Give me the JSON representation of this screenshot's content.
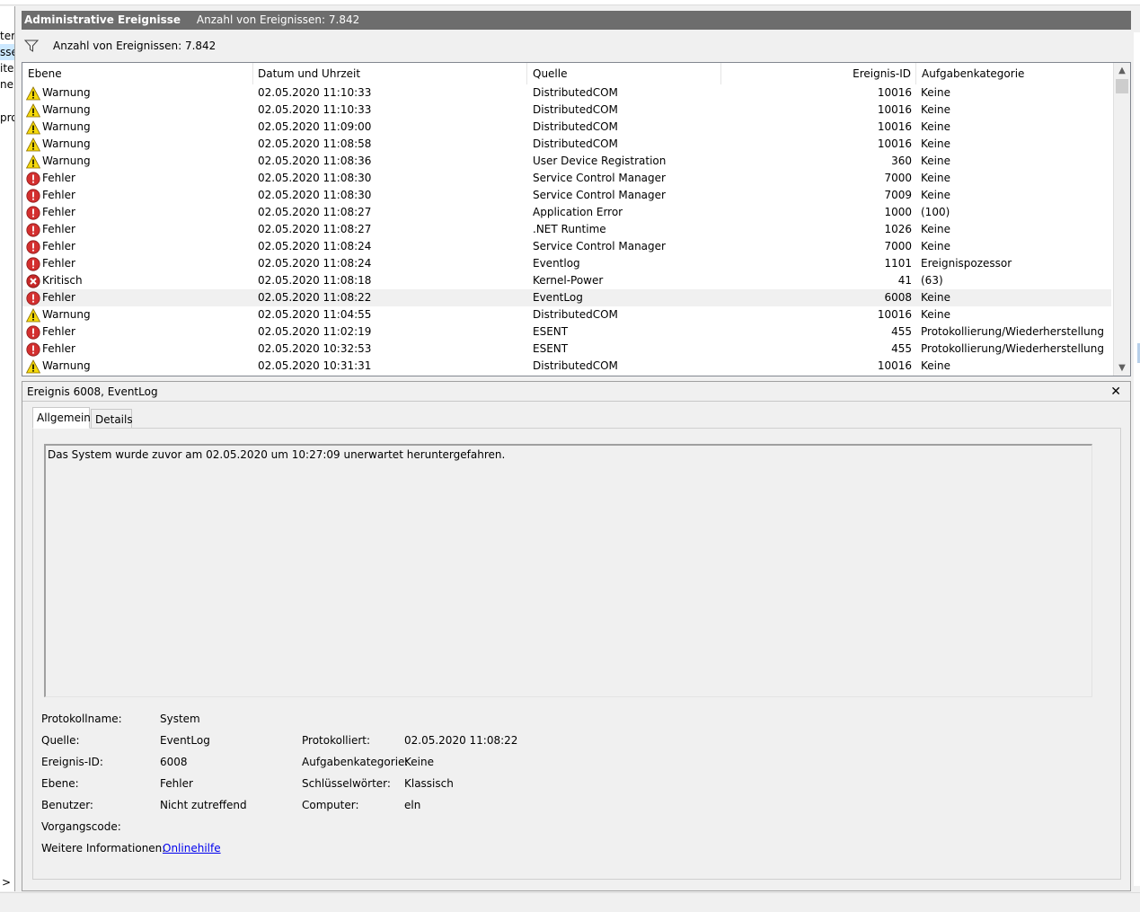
{
  "window": {
    "title_bold": "Administrative Ereignisse",
    "title_count": "Anzahl von Ereignissen: 7.842"
  },
  "left_pane": {
    "fragments": [
      "ter",
      "sse",
      "ite",
      "ner",
      "pro"
    ],
    "collapse_glyph": ">"
  },
  "filter_bar": {
    "icon": "filter-icon",
    "text": "Anzahl von Ereignissen: 7.842"
  },
  "event_list": {
    "columns": [
      "Ebene",
      "Datum und Uhrzeit",
      "Quelle",
      "Ereignis-ID",
      "Aufgabenkategorie"
    ],
    "rows": [
      {
        "level": "Warnung",
        "icon": "warning-icon",
        "date": "02.05.2020 11:10:33",
        "source": "DistributedCOM",
        "id": "10016",
        "category": "Keine"
      },
      {
        "level": "Warnung",
        "icon": "warning-icon",
        "date": "02.05.2020 11:10:33",
        "source": "DistributedCOM",
        "id": "10016",
        "category": "Keine"
      },
      {
        "level": "Warnung",
        "icon": "warning-icon",
        "date": "02.05.2020 11:09:00",
        "source": "DistributedCOM",
        "id": "10016",
        "category": "Keine"
      },
      {
        "level": "Warnung",
        "icon": "warning-icon",
        "date": "02.05.2020 11:08:58",
        "source": "DistributedCOM",
        "id": "10016",
        "category": "Keine"
      },
      {
        "level": "Warnung",
        "icon": "warning-icon",
        "date": "02.05.2020 11:08:36",
        "source": "User Device Registration",
        "id": "360",
        "category": "Keine"
      },
      {
        "level": "Fehler",
        "icon": "error-icon",
        "date": "02.05.2020 11:08:30",
        "source": "Service Control Manager",
        "id": "7000",
        "category": "Keine"
      },
      {
        "level": "Fehler",
        "icon": "error-icon",
        "date": "02.05.2020 11:08:30",
        "source": "Service Control Manager",
        "id": "7009",
        "category": "Keine"
      },
      {
        "level": "Fehler",
        "icon": "error-icon",
        "date": "02.05.2020 11:08:27",
        "source": "Application Error",
        "id": "1000",
        "category": "(100)"
      },
      {
        "level": "Fehler",
        "icon": "error-icon",
        "date": "02.05.2020 11:08:27",
        "source": ".NET Runtime",
        "id": "1026",
        "category": "Keine"
      },
      {
        "level": "Fehler",
        "icon": "error-icon",
        "date": "02.05.2020 11:08:24",
        "source": "Service Control Manager",
        "id": "7000",
        "category": "Keine"
      },
      {
        "level": "Fehler",
        "icon": "error-icon",
        "date": "02.05.2020 11:08:24",
        "source": "Eventlog",
        "id": "1101",
        "category": "Ereignispozessor"
      },
      {
        "level": "Kritisch",
        "icon": "critical-icon",
        "date": "02.05.2020 11:08:18",
        "source": "Kernel-Power",
        "id": "41",
        "category": "(63)"
      },
      {
        "level": "Fehler",
        "icon": "error-icon",
        "date": "02.05.2020 11:08:22",
        "source": "EventLog",
        "id": "6008",
        "category": "Keine",
        "selected": true
      },
      {
        "level": "Warnung",
        "icon": "warning-icon",
        "date": "02.05.2020 11:04:55",
        "source": "DistributedCOM",
        "id": "10016",
        "category": "Keine"
      },
      {
        "level": "Fehler",
        "icon": "error-icon",
        "date": "02.05.2020 11:02:19",
        "source": "ESENT",
        "id": "455",
        "category": "Protokollierung/Wiederherstellung"
      },
      {
        "level": "Fehler",
        "icon": "error-icon",
        "date": "02.05.2020 10:32:53",
        "source": "ESENT",
        "id": "455",
        "category": "Protokollierung/Wiederherstellung"
      },
      {
        "level": "Warnung",
        "icon": "warning-icon",
        "date": "02.05.2020 10:31:31",
        "source": "DistributedCOM",
        "id": "10016",
        "category": "Keine"
      }
    ]
  },
  "detail": {
    "header": "Ereignis 6008, EventLog",
    "close_glyph": "✕",
    "tabs": [
      "Allgemein",
      "Details"
    ],
    "active_tab": "Allgemein",
    "message": "Das System wurde zuvor am 02.05.2020 um 10:27:09 unerwartet heruntergefahren.",
    "properties": {
      "protokollname_label": "Protokollname:",
      "protokollname_value": "System",
      "quelle_label": "Quelle:",
      "quelle_value": "EventLog",
      "protokolliert_label": "Protokolliert:",
      "protokolliert_value": "02.05.2020 11:08:22",
      "ereignisid_label": "Ereignis-ID:",
      "ereignisid_value": "6008",
      "aufgabenkategorie_label": "Aufgabenkategorie:",
      "aufgabenkategorie_value": "Keine",
      "ebene_label": "Ebene:",
      "ebene_value": "Fehler",
      "schluesselwoerter_label": "Schlüsselwörter:",
      "schluesselwoerter_value": "Klassisch",
      "benutzer_label": "Benutzer:",
      "benutzer_value": "Nicht zutreffend",
      "computer_label": "Computer:",
      "computer_value": "eln",
      "vorgangscode_label": "Vorgangscode:",
      "weitere_label": "Weitere Informationen:",
      "weitere_link": "Onlinehilfe"
    }
  },
  "colors": {
    "titlebar_bg": "#6d6d6d",
    "warning": "#f5d90a",
    "error": "#d32f2f",
    "critical": "#c62828",
    "selected_row": "#f0f0f0",
    "link": "#0000ee"
  }
}
